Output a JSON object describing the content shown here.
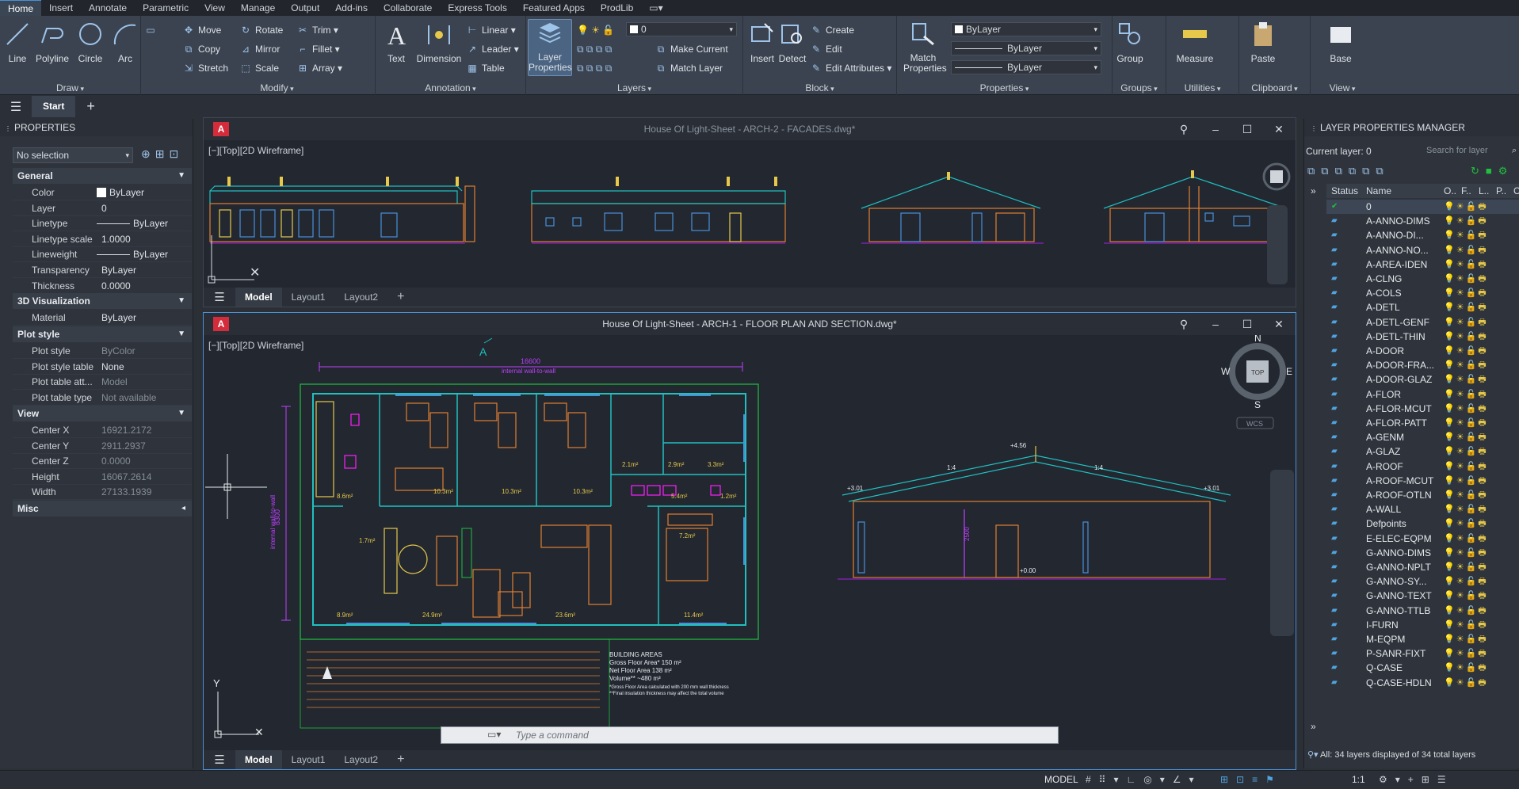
{
  "menu_tabs": [
    "Home",
    "Insert",
    "Annotate",
    "Parametric",
    "View",
    "Manage",
    "Output",
    "Add-ins",
    "Collaborate",
    "Express Tools",
    "Featured Apps",
    "ProdLib"
  ],
  "ribbon": {
    "draw": {
      "title": "Draw",
      "line": "Line",
      "polyline": "Polyline",
      "circle": "Circle",
      "arc": "Arc"
    },
    "modify": {
      "title": "Modify",
      "move": "Move",
      "rotate": "Rotate",
      "trim": "Trim",
      "copy": "Copy",
      "mirror": "Mirror",
      "fillet": "Fillet",
      "stretch": "Stretch",
      "scale": "Scale",
      "array": "Array"
    },
    "annotation": {
      "title": "Annotation",
      "text": "Text",
      "dimension": "Dimension",
      "linear": "Linear",
      "leader": "Leader",
      "table": "Table"
    },
    "layers": {
      "title": "Layers",
      "layer_properties_1": "Layer",
      "layer_properties_2": "Properties",
      "current_layer": "0",
      "make_current": "Make Current",
      "match_layer": "Match Layer"
    },
    "block": {
      "title": "Block",
      "insert": "Insert",
      "detect": "Detect",
      "create": "Create",
      "edit": "Edit",
      "edit_attributes": "Edit Attributes"
    },
    "properties": {
      "title": "Properties",
      "match_1": "Match",
      "match_2": "Properties",
      "color": "ByLayer",
      "lineweight": "ByLayer",
      "linetype": "ByLayer"
    },
    "groups": {
      "title": "Groups",
      "group": "Group"
    },
    "utilities": {
      "title": "Utilities",
      "measure": "Measure"
    },
    "clipboard": {
      "title": "Clipboard",
      "paste": "Paste"
    },
    "view": {
      "title": "View",
      "base": "Base"
    }
  },
  "filetabs": {
    "start": "Start"
  },
  "properties_palette": {
    "header": "PROPERTIES",
    "selection": "No selection",
    "sections": {
      "general": "General",
      "viz3d": "3D Visualization",
      "plotstyle": "Plot style",
      "view": "View",
      "misc": "Misc"
    },
    "general": [
      {
        "k": "Color",
        "v": "ByLayer"
      },
      {
        "k": "Layer",
        "v": "0"
      },
      {
        "k": "Linetype",
        "v": "ByLayer"
      },
      {
        "k": "Linetype scale",
        "v": "1.0000"
      },
      {
        "k": "Lineweight",
        "v": "ByLayer"
      },
      {
        "k": "Transparency",
        "v": "ByLayer"
      },
      {
        "k": "Thickness",
        "v": "0.0000"
      }
    ],
    "viz3d": [
      {
        "k": "Material",
        "v": "ByLayer"
      }
    ],
    "plotstyle": [
      {
        "k": "Plot style",
        "v": "ByColor"
      },
      {
        "k": "Plot style table",
        "v": "None"
      },
      {
        "k": "Plot table att...",
        "v": "Model"
      },
      {
        "k": "Plot table type",
        "v": "Not available"
      }
    ],
    "view": [
      {
        "k": "Center X",
        "v": "16921.2172"
      },
      {
        "k": "Center Y",
        "v": "2911.2937"
      },
      {
        "k": "Center Z",
        "v": "0.0000"
      },
      {
        "k": "Height",
        "v": "16067.2614"
      },
      {
        "k": "Width",
        "v": "27133.1939"
      }
    ]
  },
  "drawing_top": {
    "title": "House Of Light-Sheet - ARCH-2 - FACADES.dwg*",
    "viewport_label": "[−][Top][2D Wireframe]",
    "layout_tabs": [
      "Model",
      "Layout1",
      "Layout2"
    ]
  },
  "drawing_main": {
    "title": "House Of Light-Sheet - ARCH-1 - FLOOR PLAN AND SECTION.dwg*",
    "viewport_label": "[−][Top][2D Wireframe]",
    "layout_tabs": [
      "Model",
      "Layout1",
      "Layout2"
    ],
    "dim_width": "16600",
    "dim_width_label": "internal wall-to-wall",
    "dim_height": "8300",
    "dim_height_label": "internal wall-to-wall",
    "section_marker": "A",
    "rooms": [
      "8.6m²",
      "10.3m²",
      "10.3m²",
      "10.3m²",
      "2.1m²",
      "2.9m²",
      "3.3m²",
      "1.7m²",
      "5.4m²",
      "1.2m²",
      "7.2m²",
      "8.9m²",
      "24.9m²",
      "23.6m²",
      "11.4m²"
    ],
    "building_areas": {
      "title": "BUILDING AREAS",
      "gross": "Gross Floor Area*   150 m²",
      "net": "Net Floor Area        138 m²",
      "volume": "Volume**              ~480 m³",
      "note1": "*Gross Floor Area calculated with 200 mm wall thickness",
      "note2": "**Final insulation thickness may affect the total volume"
    },
    "section_levels": {
      "ridge": "+4.56",
      "left_eave": "+3.01",
      "right_eave": "+3.01",
      "floor": "+0.00",
      "height_dim": "2500",
      "slope_left": "1:4",
      "slope_right": "1:4"
    },
    "viewcube": {
      "n": "N",
      "s": "S",
      "e": "E",
      "w": "W",
      "top": "TOP",
      "wcs": "WCS"
    },
    "ucs_y": "Y"
  },
  "command_line": {
    "placeholder": "Type a command"
  },
  "layer_manager": {
    "header": "LAYER PROPERTIES MANAGER",
    "current_layer": "Current layer: 0",
    "search_placeholder": "Search for layer",
    "columns": {
      "status": "Status",
      "name": "Name",
      "o": "O..",
      "f": "F..",
      "l": "L..",
      "p": "P..",
      "color": "Colo"
    },
    "layers": [
      {
        "name": "0",
        "color": "#ffffff",
        "current": true
      },
      {
        "name": "A-ANNO-DIMS",
        "color": "#ff66cc"
      },
      {
        "name": "A-ANNO-DI...",
        "color": "#ff66cc"
      },
      {
        "name": "A-ANNO-NO...",
        "color": "#66e0ff"
      },
      {
        "name": "A-AREA-IDEN",
        "color": "#ffff00"
      },
      {
        "name": "A-CLNG",
        "color": "#c06040"
      },
      {
        "name": "A-COLS",
        "color": "#c0a040"
      },
      {
        "name": "A-DETL",
        "color": "#20c040"
      },
      {
        "name": "A-DETL-GENF",
        "color": "#20c040"
      },
      {
        "name": "A-DETL-THIN",
        "color": "#4a90d9"
      },
      {
        "name": "A-DOOR",
        "color": "#e08030"
      },
      {
        "name": "A-DOOR-FRA...",
        "color": "#e08030"
      },
      {
        "name": "A-DOOR-GLAZ",
        "color": "#e08030"
      },
      {
        "name": "A-FLOR",
        "color": "#2a2aff"
      },
      {
        "name": "A-FLOR-MCUT",
        "color": "#20c0c0"
      },
      {
        "name": "A-FLOR-PATT",
        "color": "#909090"
      },
      {
        "name": "A-GENM",
        "color": "#20c0c0"
      },
      {
        "name": "A-GLAZ",
        "color": "#20a0e0"
      },
      {
        "name": "A-ROOF",
        "color": "#20c0c0"
      },
      {
        "name": "A-ROOF-MCUT",
        "color": "#20c0c0"
      },
      {
        "name": "A-ROOF-OTLN",
        "color": "#20c0c0"
      },
      {
        "name": "A-WALL",
        "color": "#209060"
      },
      {
        "name": "Defpoints",
        "color": "#ffffff"
      },
      {
        "name": "E-ELEC-EQPM",
        "color": "#80e080"
      },
      {
        "name": "G-ANNO-DIMS",
        "color": "#20c0c0"
      },
      {
        "name": "G-ANNO-NPLT",
        "color": "#c080ff"
      },
      {
        "name": "G-ANNO-SY...",
        "color": "#20c0c0"
      },
      {
        "name": "G-ANNO-TEXT",
        "color": "#e08030"
      },
      {
        "name": "G-ANNO-TTLB",
        "color": "#ff20ff"
      },
      {
        "name": "I-FURN",
        "color": "#e08030"
      },
      {
        "name": "M-EQPM",
        "color": "#e0e020"
      },
      {
        "name": "P-SANR-FIXT",
        "color": "#ff20ff"
      },
      {
        "name": "Q-CASE",
        "color": "#e08030"
      },
      {
        "name": "Q-CASE-HDLN",
        "color": "#e08030"
      }
    ],
    "footer": "All: 34 layers displayed of 34 total layers"
  },
  "statusbar": {
    "model": "MODEL",
    "scale": "1:1"
  }
}
